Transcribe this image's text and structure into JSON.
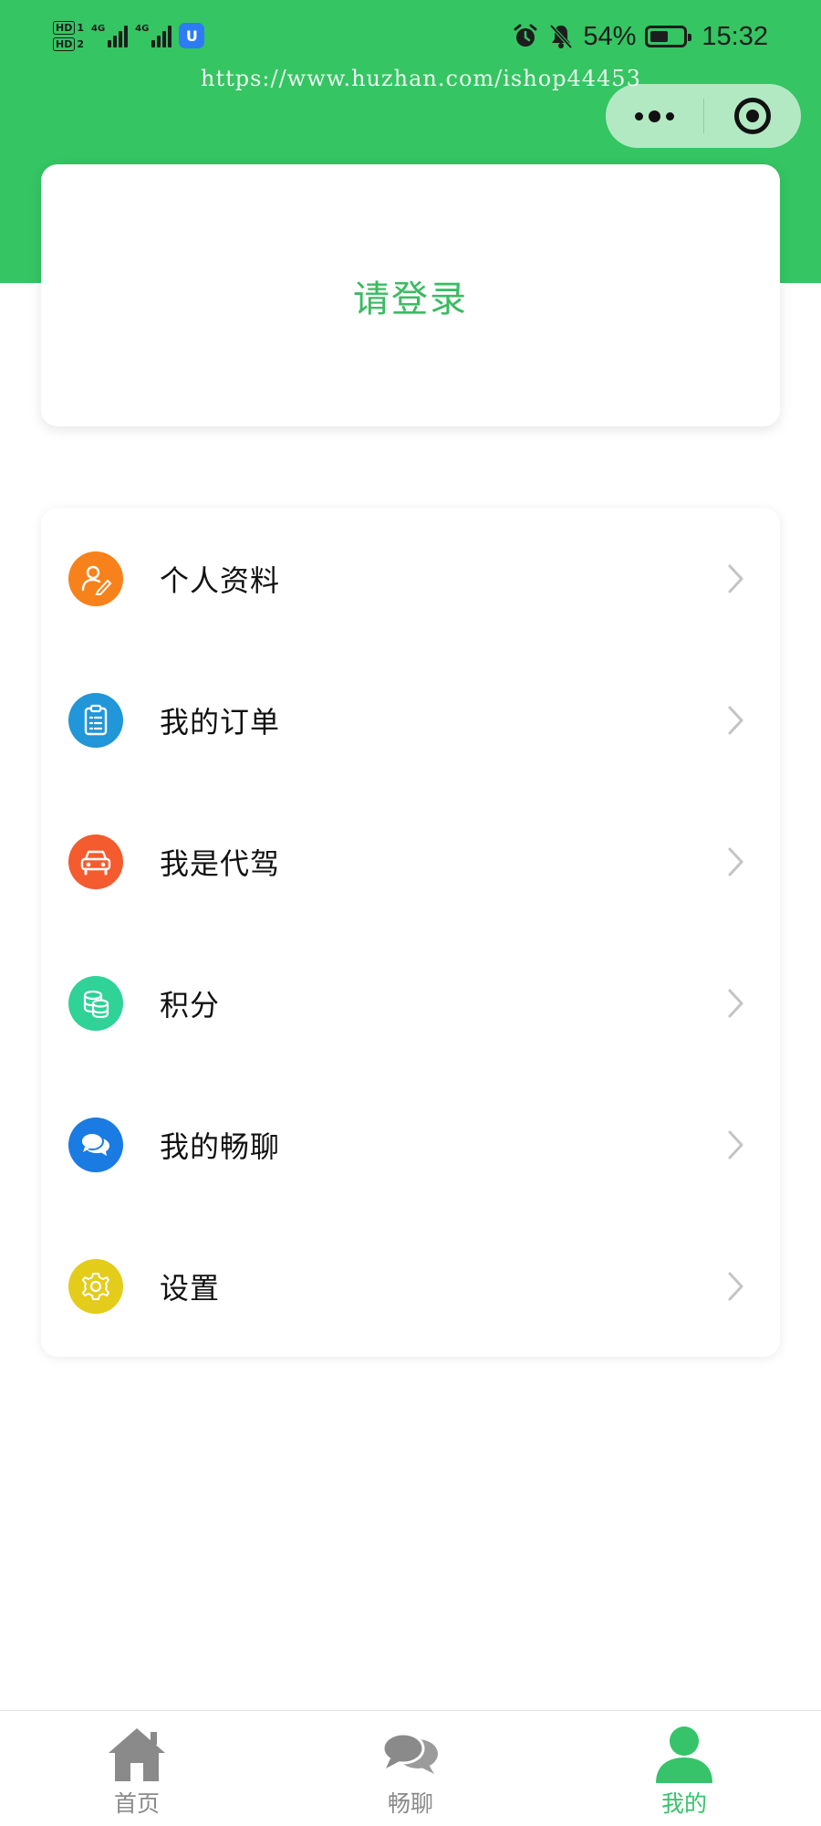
{
  "status_bar": {
    "hd1_tag": "HD",
    "hd1_num": "1",
    "hd2_tag": "HD",
    "hd2_num": "2",
    "sim1_label": "4G",
    "sim2_label": "4G",
    "battery_percent": "54%",
    "battery_level": 0.54,
    "time": "15:32",
    "app_badge_glyph": "U"
  },
  "watermark": "https://www.huzhan.com/ishop44453",
  "capsule": {
    "more_icon": "more-dots-icon",
    "close_icon": "target-close-icon"
  },
  "login": {
    "label": "请登录"
  },
  "menu": {
    "items": [
      {
        "label": "个人资料",
        "icon": "profile-edit-icon",
        "color": "#f7821b"
      },
      {
        "label": "我的订单",
        "icon": "clipboard-list-icon",
        "color": "#2196d8"
      },
      {
        "label": "我是代驾",
        "icon": "car-icon",
        "color": "#f45b2f"
      },
      {
        "label": "积分",
        "icon": "coin-stack-icon",
        "color": "#2fd297"
      },
      {
        "label": "我的畅聊",
        "icon": "chat-bubbles-icon",
        "color": "#1a7be3"
      },
      {
        "label": "设置",
        "icon": "gear-icon",
        "color": "#e4cc1a"
      }
    ]
  },
  "tabbar": {
    "tabs": [
      {
        "label": "首页",
        "icon": "home-icon",
        "active": false
      },
      {
        "label": "畅聊",
        "icon": "chat-icon",
        "active": false
      },
      {
        "label": "我的",
        "icon": "user-icon",
        "active": true
      }
    ],
    "active_color": "#36c36a",
    "inactive_color": "#8a8a8a"
  },
  "colors": {
    "header_green": "#35c563",
    "login_text_green": "#3bbb62"
  }
}
